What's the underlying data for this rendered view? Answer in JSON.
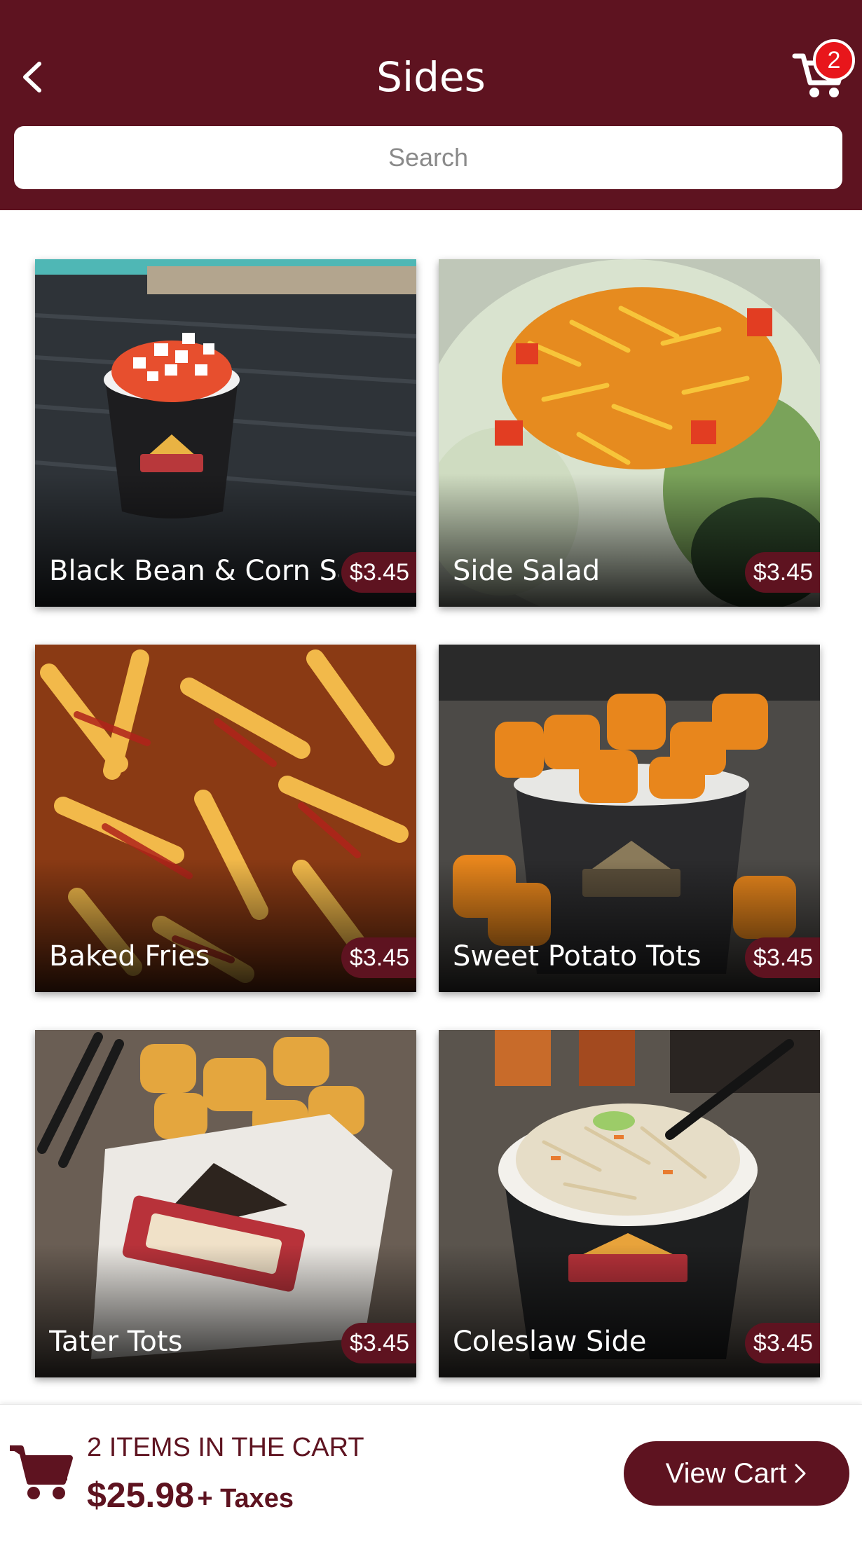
{
  "header": {
    "title": "Sides",
    "cart_count": "2"
  },
  "search": {
    "placeholder": "Search"
  },
  "items": [
    {
      "name": "Black Bean & Corn Salad",
      "price": "$3.45",
      "image": "photo-salsa-cup"
    },
    {
      "name": "Side Salad",
      "price": "$3.45",
      "image": "photo-side-salad"
    },
    {
      "name": "Baked Fries",
      "price": "$3.45",
      "image": "photo-fries"
    },
    {
      "name": "Sweet Potato Tots",
      "price": "$3.45",
      "image": "photo-sweet-potato-tots"
    },
    {
      "name": "Tater Tots",
      "price": "$3.45",
      "image": "photo-tater-tots"
    },
    {
      "name": "Coleslaw Side",
      "price": "$3.45",
      "image": "photo-coleslaw"
    }
  ],
  "footer": {
    "items_label": "2 ITEMS IN THE CART",
    "total": "$25.98",
    "taxes_label": "+ Taxes",
    "view_cart_label": "View Cart"
  },
  "colors": {
    "brand": "#5e1320",
    "badge": "#e8161b"
  },
  "icons": {
    "back": "chevron-left-icon",
    "cart": "cart-icon",
    "view_cart_arrow": "chevron-right-icon"
  }
}
